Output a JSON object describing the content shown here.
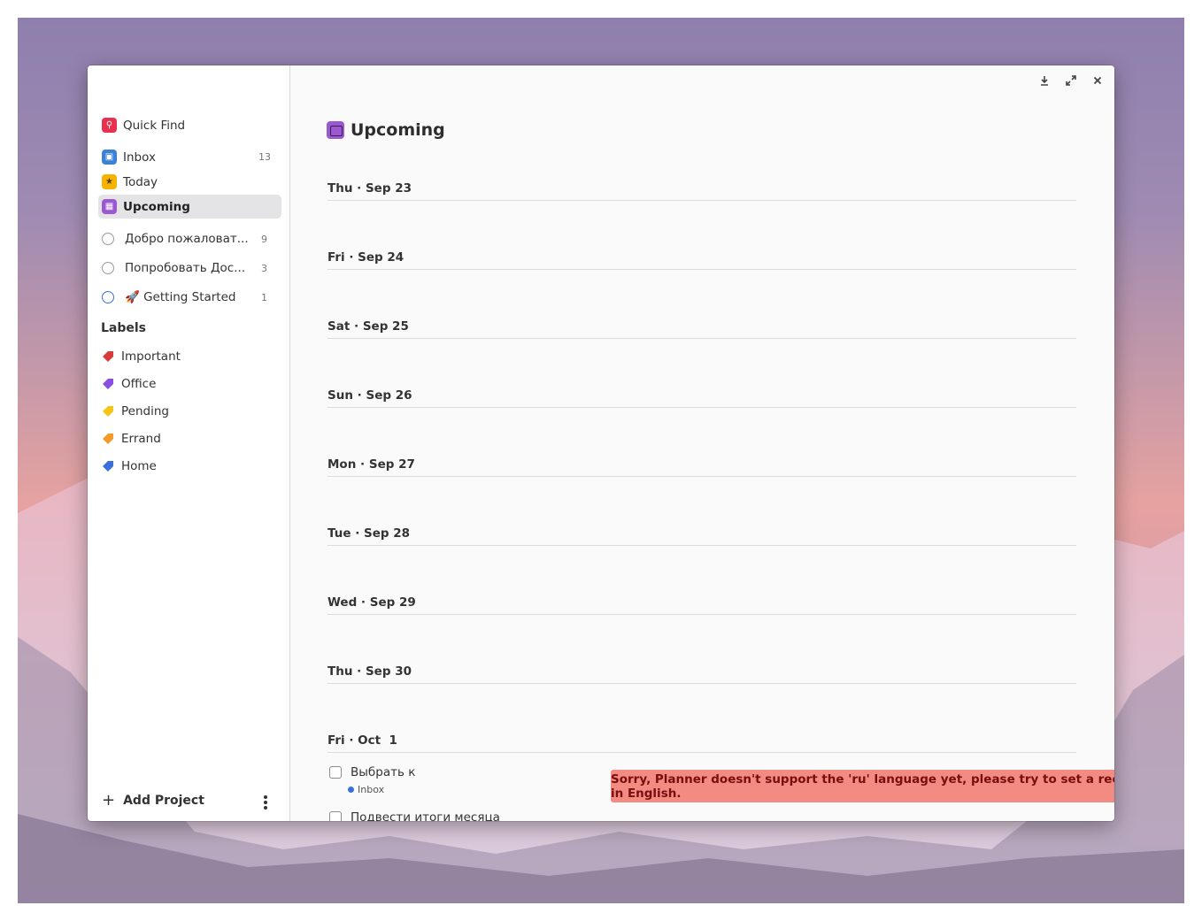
{
  "sidebar": {
    "quick_find": "Quick Find",
    "inbox": {
      "label": "Inbox",
      "count": "13"
    },
    "today": {
      "label": "Today"
    },
    "upcoming": {
      "label": "Upcoming"
    },
    "projects": [
      {
        "label": "Добро пожаловат...",
        "count": "9"
      },
      {
        "label": "Попробовать Дос...",
        "count": "3"
      },
      {
        "label": "🚀 Getting Started",
        "count": "1"
      }
    ],
    "labels_heading": "Labels",
    "labels": [
      {
        "label": "Important",
        "color": "#d93a3a"
      },
      {
        "label": "Office",
        "color": "#8a4fe0"
      },
      {
        "label": "Pending",
        "color": "#f5c518"
      },
      {
        "label": "Errand",
        "color": "#f39a2b"
      },
      {
        "label": "Home",
        "color": "#3b6fd9"
      }
    ],
    "add_project": "Add Project"
  },
  "main": {
    "title": "Upcoming",
    "days": [
      "Thu · Sep 23",
      "Fri · Sep 24",
      "Sat · Sep 25",
      "Sun · Sep 26",
      "Mon · Sep 27",
      "Tue · Sep 28",
      "Wed · Sep 29",
      "Thu · Sep 30",
      "Fri · Oct  1"
    ],
    "tasks": [
      {
        "label": "Выбрать к",
        "project": "Inbox"
      },
      {
        "label": "Подвести итоги месяца"
      }
    ],
    "toast": "Sorry, Planner doesn't support the 'ru' language yet, please try to set a recurring task in English.",
    "fab_icon": "plus-icon"
  },
  "colors": {
    "accent": "#3d8ee8",
    "toast_bg": "#f28b82",
    "upcoming_icon": "#9b59d0"
  }
}
